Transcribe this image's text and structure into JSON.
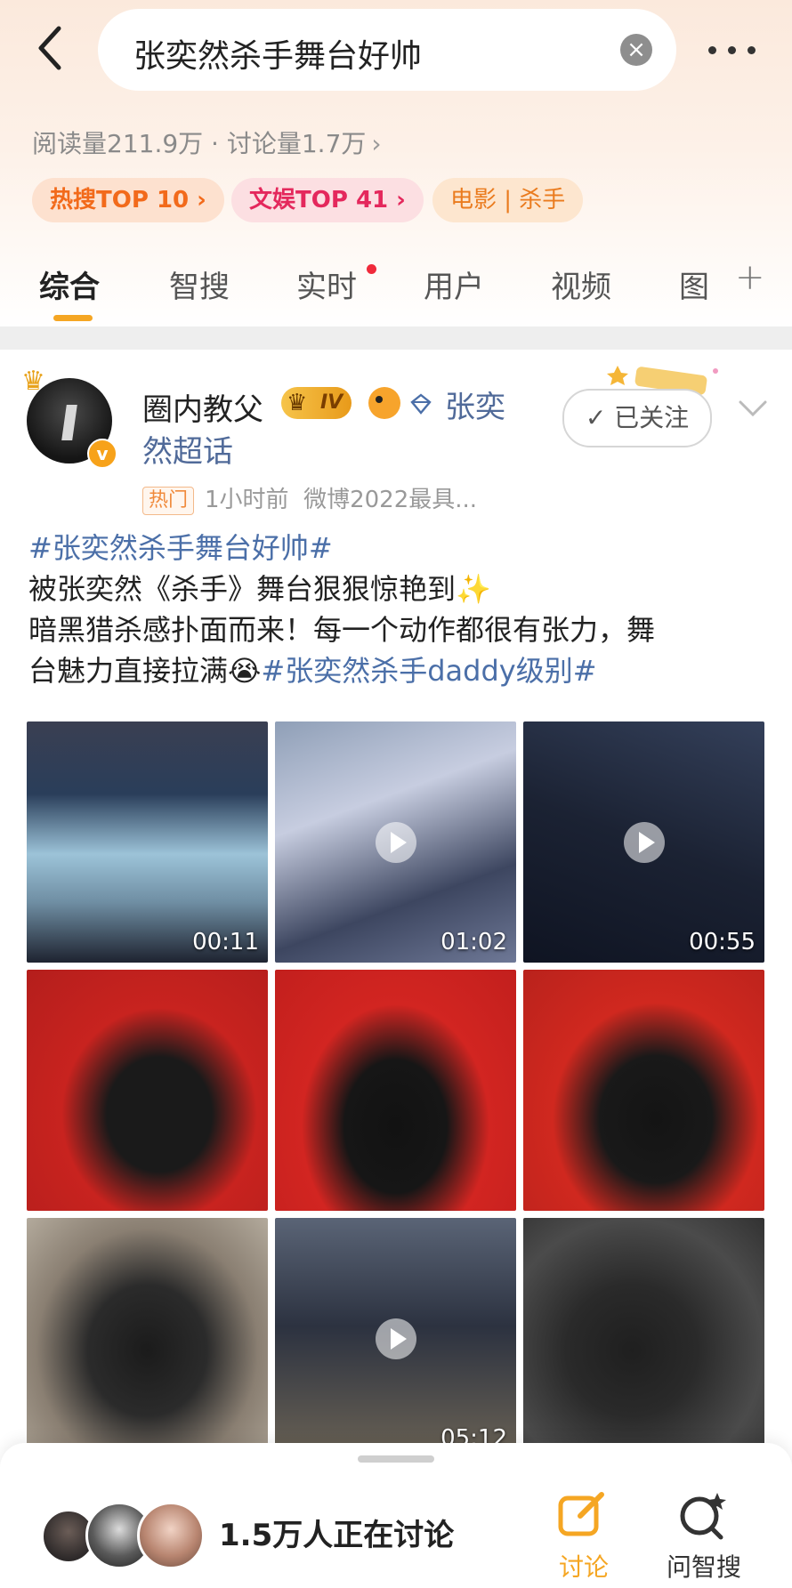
{
  "search": {
    "query": "张奕然杀手舞台好帅"
  },
  "stats": {
    "text": "阅读量211.9万 · 讨论量1.7万"
  },
  "tags": [
    {
      "label": "热搜TOP 10 ›"
    },
    {
      "label": "文娱TOP 41 ›"
    },
    {
      "label": "电影 | 杀手"
    }
  ],
  "tabs": [
    {
      "label": "综合"
    },
    {
      "label": "智搜"
    },
    {
      "label": "实时"
    },
    {
      "label": "用户"
    },
    {
      "label": "视频"
    },
    {
      "label": "图"
    }
  ],
  "post": {
    "username": "圈内教父",
    "vip_level": "IV",
    "supertopic": "张奕然超话",
    "follow_label": "✓ 已关注",
    "hot_badge": "热门",
    "time": "1小时前",
    "source": "微博2022最具...",
    "text": {
      "topic1": "#张奕然杀手舞台好帅#",
      "line2": "被张奕然《杀手》舞台狠狠惊艳到✨",
      "line3": "暗黑猎杀感扑面而来！每一个动作都很有张力，舞",
      "line4_prefix": "台魅力直接拉满😭",
      "topic2": "#张奕然杀手daddy级别#"
    },
    "media": [
      {
        "type": "video",
        "duration": "00:11"
      },
      {
        "type": "video",
        "duration": "01:02"
      },
      {
        "type": "video",
        "duration": "00:55"
      },
      {
        "type": "image"
      },
      {
        "type": "image"
      },
      {
        "type": "image"
      },
      {
        "type": "image"
      },
      {
        "type": "video",
        "duration": "05:12"
      },
      {
        "type": "image"
      }
    ]
  },
  "bottom": {
    "discuss_count": "1.5万人正在讨论",
    "discuss_label": "讨论",
    "ask_label": "问智搜"
  },
  "colors": {
    "accent": "#f5a623",
    "topic_link": "#4b6fa8",
    "hot_tag": "#f26a1b"
  }
}
